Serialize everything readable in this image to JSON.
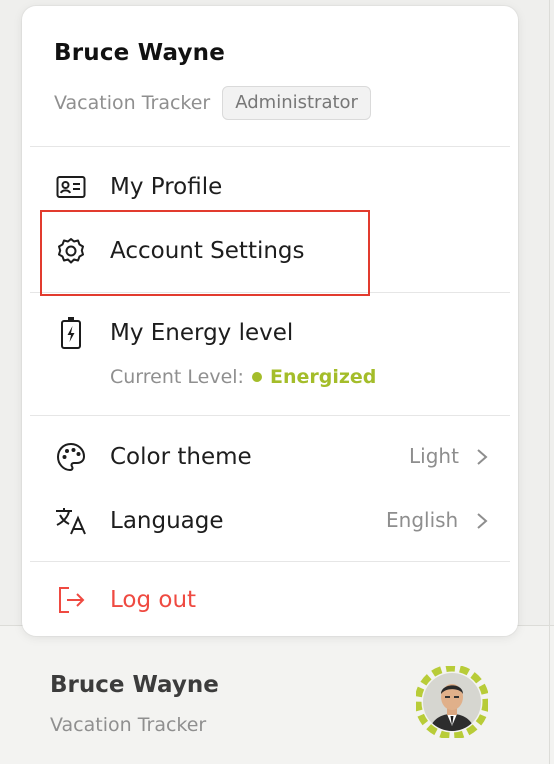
{
  "user": {
    "name": "Bruce Wayne",
    "organization": "Vacation Tracker",
    "role": "Administrator"
  },
  "menu": {
    "my_profile": "My Profile",
    "account_settings": "Account Settings",
    "energy": {
      "label": "My Energy level",
      "current_prefix": "Current Level:",
      "current_value": "Energized",
      "status_color": "#a4bd2a"
    },
    "color_theme": {
      "label": "Color theme",
      "value": "Light"
    },
    "language": {
      "label": "Language",
      "value": "English"
    },
    "logout": "Log out"
  },
  "footer": {
    "name": "Bruce Wayne",
    "organization": "Vacation Tracker"
  },
  "colors": {
    "accent_green": "#a4bd2a",
    "logout_red": "#ef4a41",
    "highlight_red": "#e23b2e"
  },
  "icons": [
    "id-card-icon",
    "gear-icon",
    "battery-charging-icon",
    "palette-icon",
    "translate-icon",
    "logout-icon",
    "chevron-right-icon"
  ]
}
